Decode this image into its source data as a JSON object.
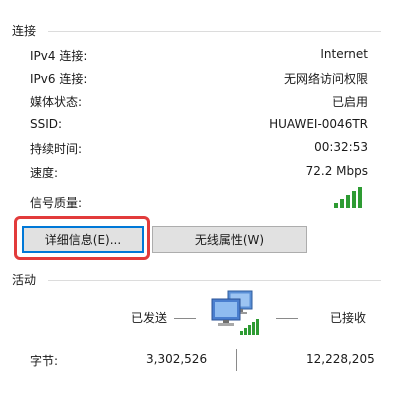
{
  "connection": {
    "section_title": "连接",
    "rows": [
      {
        "label": "IPv4 连接:",
        "value": "Internet"
      },
      {
        "label": "IPv6 连接:",
        "value": "无网络访问权限"
      },
      {
        "label": "媒体状态:",
        "value": "已启用"
      },
      {
        "label": "SSID:",
        "value": "HUAWEI-0046TR"
      },
      {
        "label": "持续时间:",
        "value": "00:32:53"
      },
      {
        "label": "速度:",
        "value": "72.2 Mbps"
      }
    ],
    "signal_label": "信号质量:",
    "signal_icon": "signal-strength-icon",
    "signal_bars_active": 5,
    "signal_color": "#2e9b33"
  },
  "buttons": {
    "details_label": "详细信息(E)...",
    "wireless_props_label": "无线属性(W)"
  },
  "highlight_color": "#e23b3b",
  "activity": {
    "section_title": "活动",
    "sent_label": "已发送",
    "received_label": "已接收",
    "network_icon": "network-computers-icon",
    "bytes_label": "字节:",
    "bytes_sent": "3,302,526",
    "bytes_received": "12,228,205"
  }
}
